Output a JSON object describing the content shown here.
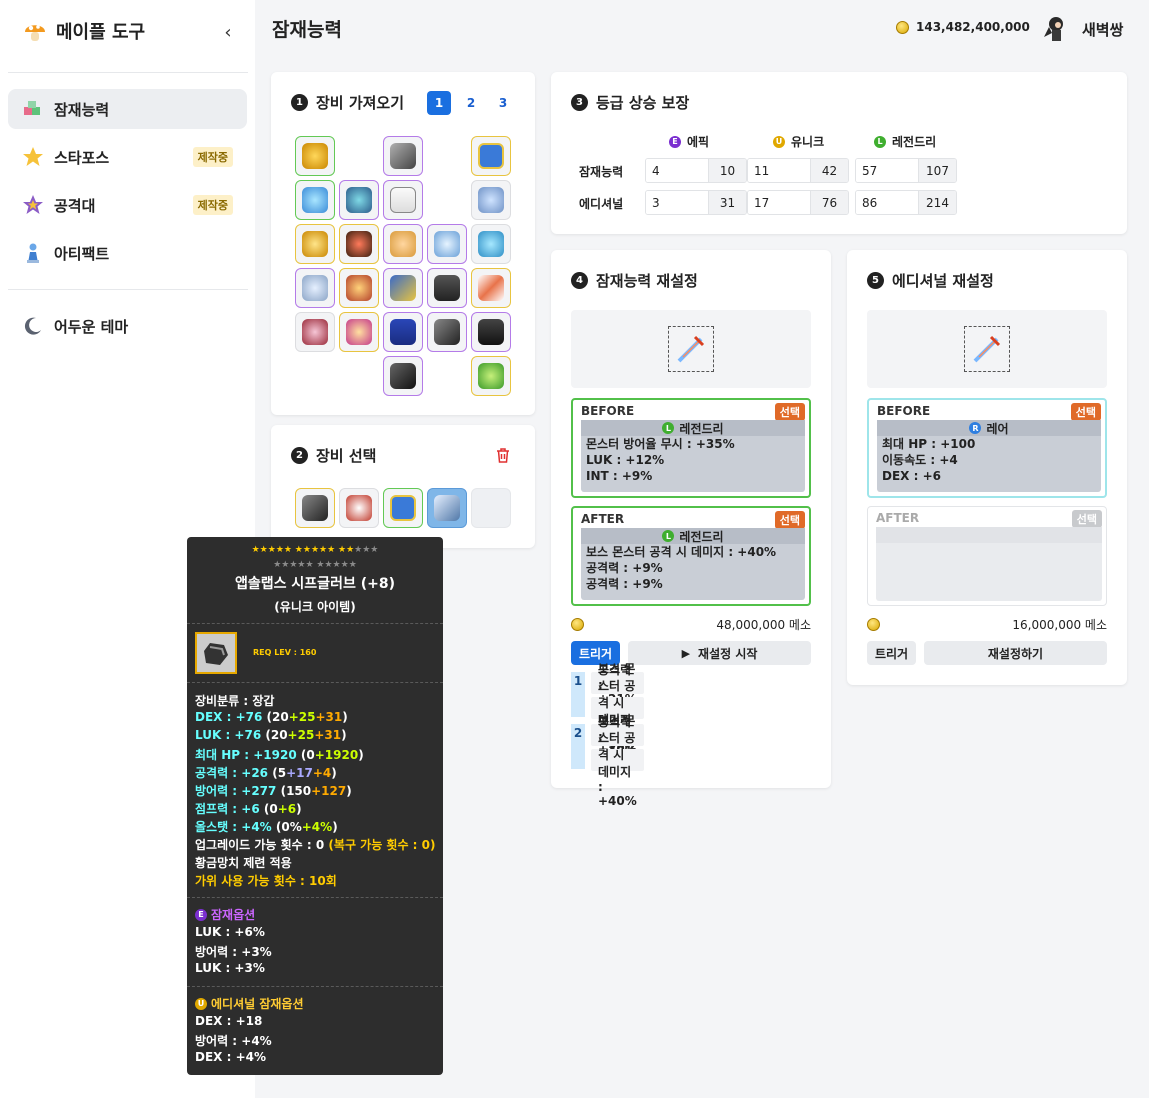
{
  "sidebar": {
    "title": "메이플 도구",
    "collapse_icon": "‹",
    "items": [
      {
        "label": "잠재능력",
        "icon": "cube-icon",
        "badge": ""
      },
      {
        "label": "스타포스",
        "icon": "star-icon",
        "badge": "제작중"
      },
      {
        "label": "공격대",
        "icon": "raid-star-icon",
        "badge": "제작중"
      },
      {
        "label": "아티팩트",
        "icon": "artifact-icon",
        "badge": ""
      }
    ],
    "theme_label": "어두운 테마"
  },
  "header": {
    "title": "잠재능력",
    "meso": "143,482,400,000",
    "username": "새벽쌍"
  },
  "equip_load": {
    "title": "장비 가져오기",
    "num": "1",
    "pages": [
      "1",
      "2",
      "3"
    ],
    "active_page": "1"
  },
  "equip_select": {
    "title": "장비 선택",
    "num": "2"
  },
  "grade": {
    "title": "등급 상승 보장",
    "num": "3",
    "columns": [
      {
        "label": "에픽",
        "mark": "E",
        "color": "#7b2fd0"
      },
      {
        "label": "유니크",
        "mark": "U",
        "color": "#e0a800"
      },
      {
        "label": "레전드리",
        "mark": "L",
        "color": "#3fae2f"
      }
    ],
    "rows": [
      {
        "label": "잠재능력",
        "values": [
          [
            "4",
            "10"
          ],
          [
            "11",
            "42"
          ],
          [
            "57",
            "107"
          ]
        ]
      },
      {
        "label": "에디셔널",
        "values": [
          [
            "3",
            "31"
          ],
          [
            "17",
            "76"
          ],
          [
            "86",
            "214"
          ]
        ]
      }
    ]
  },
  "potential_reset": {
    "title": "잠재능력 재설정",
    "num": "4",
    "before_label": "BEFORE",
    "after_label": "AFTER",
    "select_label": "선택",
    "before": {
      "grade": "레전드리",
      "lines": [
        "몬스터 방어율 무시 : +35%",
        "LUK : +12%",
        "INT : +9%"
      ]
    },
    "after": {
      "grade": "레전드리",
      "lines": [
        "보스 몬스터 공격 시 데미지 : +40%",
        "공격력 : +9%",
        "공격력 : +9%"
      ]
    },
    "cost": "48,000,000 메소",
    "trigger_label": "트리거",
    "start_label": "재설정 시작",
    "history": [
      {
        "num": "1",
        "lines": [
          "공격력 : +21%",
          "보스 몬스터 공격 시 데미지 : +30%"
        ]
      },
      {
        "num": "2",
        "lines": [
          "공격력 : +18%",
          "보스 몬스터 공격 시 데미지 : +40%"
        ]
      }
    ]
  },
  "additional_reset": {
    "title": "에디셔널 재설정",
    "num": "5",
    "before_label": "BEFORE",
    "after_label": "AFTER",
    "select_label": "선택",
    "before": {
      "grade": "레어",
      "lines": [
        "최대 HP : +100",
        "이동속도 : +4",
        "DEX : +6"
      ]
    },
    "cost": "16,000,000 메소",
    "trigger_label": "트리거",
    "reset_label": "재설정하기"
  },
  "tooltip": {
    "name": "앱솔랩스 시프글러브 (+8)",
    "subtitle": "(유니크 아이템)",
    "stars_row1": "★★★★★ ★★★★★ ★★",
    "stars_row1_dim": "★★★",
    "stars_row2": "★★★★★ ★★★★★",
    "req_level": "REQ LEV : 160",
    "category": "장비분류 : 장갑",
    "stats": [
      {
        "k": "DEX : +76",
        "base": "20",
        "a": "+25",
        "b": "+31",
        "ca": "c-green",
        "cb": "c-orange"
      },
      {
        "k": "LUK : +76",
        "base": "20",
        "a": "+25",
        "b": "+31",
        "ca": "c-green",
        "cb": "c-orange"
      },
      {
        "k": "최대 HP : +1920",
        "base": "0",
        "a": "+1920",
        "b": "",
        "ca": "c-green",
        "cb": "c-orange"
      },
      {
        "k": "공격력 : +26",
        "base": "5",
        "a": "+17",
        "b": "+4",
        "ca": "c-blue",
        "cb": "c-orange"
      },
      {
        "k": "방어력 : +277",
        "base": "150",
        "a": "+127",
        "b": "",
        "ca": "c-orange",
        "cb": "c-orange"
      },
      {
        "k": "점프력 : +6",
        "base": "0",
        "a": "+6",
        "b": "",
        "ca": "c-green",
        "cb": "c-orange"
      },
      {
        "k": "올스탯 : +4%",
        "base": "0%",
        "a": "+4%",
        "b": "",
        "ca": "c-green",
        "cb": "c-orange"
      }
    ],
    "upgrade": "업그레이드 가능 횟수 : 0",
    "upgrade_restore": "(복구 가능 횟수 : 0)",
    "hammer": "황금망치 제련 적용",
    "scissors": "가위 사용 가능 횟수 : 10회",
    "potential_title": "잠재옵션",
    "potential_lines": [
      "LUK : +6%",
      "방어력 : +3%",
      "LUK : +3%"
    ],
    "additional_title": "에디셔널 잠재옵션",
    "additional_lines": [
      "DEX : +18",
      "방어력 : +4%",
      "DEX : +4%"
    ]
  },
  "colors": {
    "primary": "#1a6fe0",
    "legendary": "#52c04a",
    "epic": "#b47be8",
    "unique": "#e8c440",
    "select_orange": "#e06a28"
  }
}
